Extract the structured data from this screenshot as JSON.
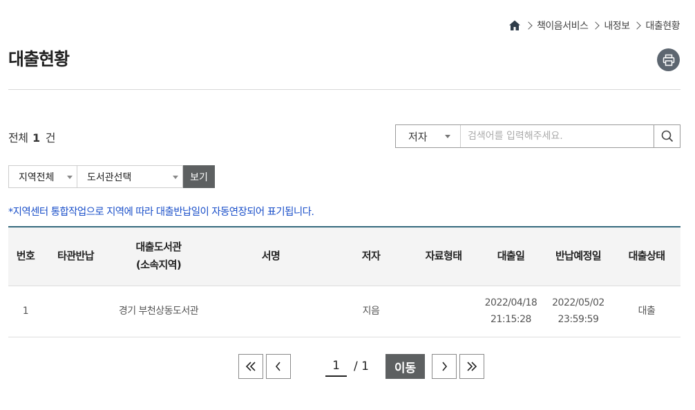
{
  "breadcrumb": {
    "items": [
      "책이음서비스",
      "내정보",
      "대출현황"
    ]
  },
  "page": {
    "title": "대출현황"
  },
  "summary": {
    "prefix": "전체",
    "count": "1",
    "unit": "건"
  },
  "search": {
    "field_selected": "저자",
    "placeholder": "검색어를 입력해주세요.",
    "value": ""
  },
  "filters": {
    "region_selected": "지역전체",
    "library_selected": "도서관선택",
    "view_label": "보기"
  },
  "notice": "*지역센터 통합작업으로 지역에 따라 대출반납일이 자동연장되어 표기됩니다.",
  "table": {
    "headers": {
      "no": "번호",
      "other_return": "타관반납",
      "library_line1": "대출도서관",
      "library_line2": "(소속지역)",
      "title": "서명",
      "author": "저자",
      "format": "자료형태",
      "loan_date": "대출일",
      "due_date": "반납예정일",
      "status": "대출상태"
    },
    "rows": [
      {
        "no": "1",
        "other_return": "",
        "library": "경기 부천상동도서관",
        "title": "",
        "author": "지음",
        "format": "",
        "loan_date": "2022/04/18",
        "loan_time": "21:15:28",
        "due_date": "2022/05/02",
        "due_time": "23:59:59",
        "status": "대출"
      }
    ]
  },
  "pagination": {
    "current": "1",
    "total": "/ 1",
    "go_label": "이동"
  },
  "colors": {
    "accent_blue": "#1a4fc9",
    "table_top_border": "#34697d",
    "button_dark": "#5d6061",
    "print_button_bg": "#5d6670"
  },
  "icons": [
    "home-icon",
    "chevron-right-icon",
    "print-icon",
    "search-icon",
    "first-page-icon",
    "prev-page-icon",
    "next-page-icon",
    "last-page-icon"
  ]
}
